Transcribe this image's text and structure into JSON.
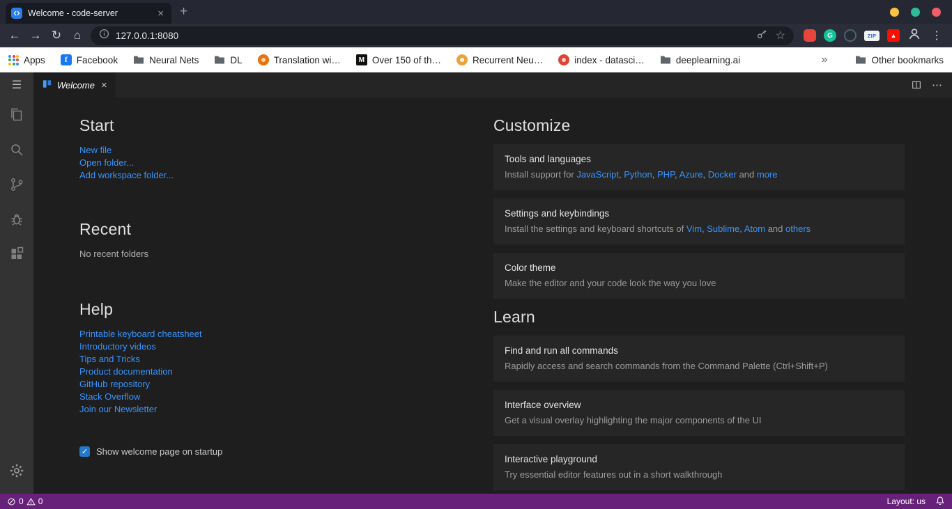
{
  "browser": {
    "tab_title": "Welcome - code-server",
    "url": "127.0.0.1:8080",
    "bookmarks": {
      "apps": "Apps",
      "facebook": "Facebook",
      "neural_nets": "Neural Nets",
      "dl": "DL",
      "translation": "Translation wi…",
      "over150": "Over 150 of th…",
      "recurrent": "Recurrent Neu…",
      "index_datasci": "index - datasci…",
      "deeplearning": "deeplearning.ai",
      "chevron": "»",
      "other": "Other bookmarks"
    }
  },
  "icons": {
    "back": "←",
    "forward": "→",
    "reload": "↻",
    "home": "⌂",
    "plus": "+",
    "close": "×",
    "kebab": "⋮",
    "ellipsis": "⋯",
    "hamburger": "☰",
    "star": "☆",
    "check": "✓",
    "facebook_f": "f",
    "medium_m": "M",
    "zip": "ZIP",
    "grammarly_g": "G",
    "adobe": "▲"
  },
  "vscode": {
    "tab": "Welcome",
    "start": {
      "heading": "Start",
      "links": [
        "New file",
        "Open folder...",
        "Add workspace folder..."
      ]
    },
    "recent": {
      "heading": "Recent",
      "empty": "No recent folders"
    },
    "help": {
      "heading": "Help",
      "links": [
        "Printable keyboard cheatsheet",
        "Introductory videos",
        "Tips and Tricks",
        "Product documentation",
        "GitHub repository",
        "Stack Overflow",
        "Join our Newsletter"
      ]
    },
    "startup": {
      "label": "Show welcome page on startup",
      "checked": true
    },
    "customize": {
      "heading": "Customize",
      "cards": [
        {
          "title": "Tools and languages",
          "segments": [
            {
              "t": "Install support for "
            },
            {
              "t": "JavaScript",
              "link": true
            },
            {
              "t": ", "
            },
            {
              "t": "Python",
              "link": true
            },
            {
              "t": ", "
            },
            {
              "t": "PHP",
              "link": true
            },
            {
              "t": ", "
            },
            {
              "t": "Azure",
              "link": true
            },
            {
              "t": ", "
            },
            {
              "t": "Docker",
              "link": true
            },
            {
              "t": " and "
            },
            {
              "t": "more",
              "link": true
            }
          ]
        },
        {
          "title": "Settings and keybindings",
          "segments": [
            {
              "t": "Install the settings and keyboard shortcuts of "
            },
            {
              "t": "Vim",
              "link": true
            },
            {
              "t": ", "
            },
            {
              "t": "Sublime",
              "link": true
            },
            {
              "t": ", "
            },
            {
              "t": "Atom",
              "link": true
            },
            {
              "t": " and "
            },
            {
              "t": "others",
              "link": true
            }
          ]
        },
        {
          "title": "Color theme",
          "segments": [
            {
              "t": "Make the editor and your code look the way you love"
            }
          ]
        }
      ]
    },
    "learn": {
      "heading": "Learn",
      "cards": [
        {
          "title": "Find and run all commands",
          "segments": [
            {
              "t": "Rapidly access and search commands from the Command Palette (Ctrl+Shift+P)"
            }
          ]
        },
        {
          "title": "Interface overview",
          "segments": [
            {
              "t": "Get a visual overlay highlighting the major components of the UI"
            }
          ]
        },
        {
          "title": "Interactive playground",
          "segments": [
            {
              "t": "Try essential editor features out in a short walkthrough"
            }
          ]
        }
      ]
    }
  },
  "statusbar": {
    "errors": "0",
    "warnings": "0",
    "layout": "Layout: us"
  },
  "colors": {
    "statusbar": "#68217a",
    "link": "#3794ff",
    "editor_bg": "#1e1e1e",
    "activitybar_bg": "#333333",
    "card_bg": "#262626",
    "window_controls": [
      "#f9c440",
      "#2dbd9b",
      "#f25d6a"
    ]
  }
}
